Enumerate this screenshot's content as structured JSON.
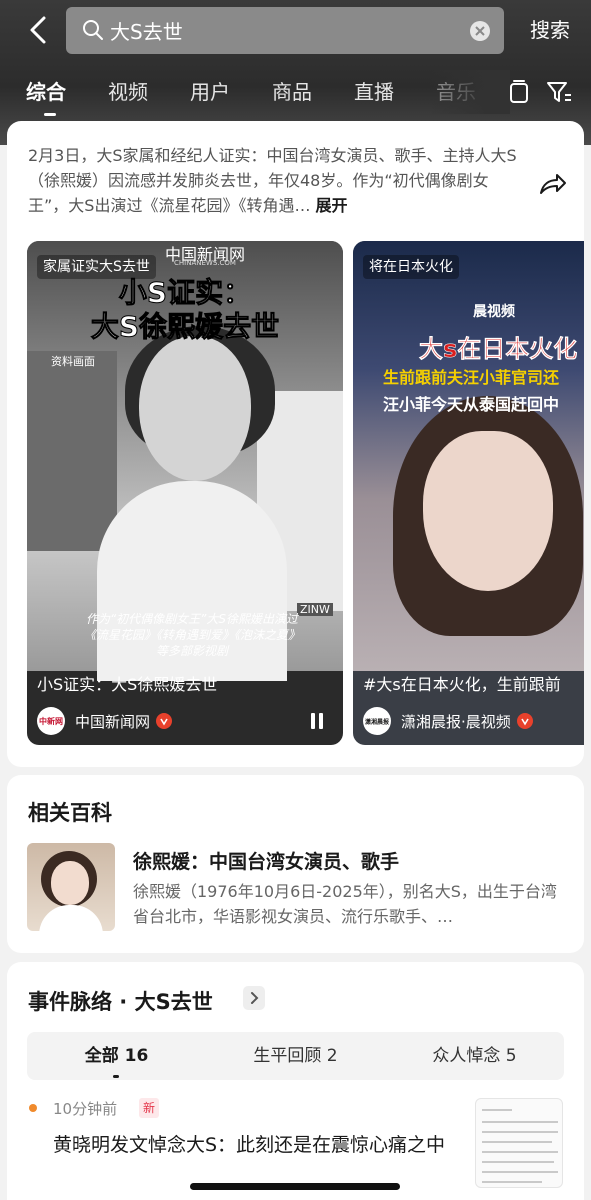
{
  "header": {
    "search_value": "大S去世",
    "search_button": "搜索",
    "tabs": [
      "综合",
      "视频",
      "用户",
      "商品",
      "直播",
      "音乐"
    ]
  },
  "summary": {
    "text": "2月3日，大S家属和经纪人证实：中国台湾女演员、歌手、主持人大S（徐熙媛）因流感并发肺炎去世，年仅48岁。作为“初代偶像剧女王”，大S出演过《流星花园》《转角遇…",
    "expand_label": "展开"
  },
  "videos": [
    {
      "badge": "家属证实大S去世",
      "logo_top": "中国新闻网",
      "logo_sub": "CHINANEWS.COM",
      "headline_line1": "小S证实：",
      "headline_line2": "大S徐熙媛去世",
      "archive_label": "资料画面",
      "overlay_caption": "作为“初代偶像剧女王”大S徐熙媛出演过《流星花园》《转角遇到爱》《泡沫之夏》等多部影视剧",
      "stage_sign": "ZINW",
      "caption": "小S证实：大S徐熙媛去世",
      "source_logo_text": "中新网",
      "source": "中国新闻网"
    },
    {
      "badge": "将在日本火化",
      "logo": "晨视频",
      "overlay_red": "大s在日本火化",
      "overlay_yellow": "生前跟前夫汪小菲官司还",
      "overlay_white": "汪小菲今天从泰国赶回中",
      "caption": "#大s在日本火化，生前跟前",
      "source_logo_text": "潇湘晨报",
      "source": "潇湘晨报·晨视频"
    }
  ],
  "wiki": {
    "section_title": "相关百科",
    "title": "徐熙媛：中国台湾女演员、歌手",
    "desc": "徐熙媛（1976年10月6日-2025年），别名大S，出生于台湾省台北市，华语影视女演员、流行乐歌手、…"
  },
  "timeline": {
    "title": "事件脉络 · 大S去世",
    "segments": [
      "全部 16",
      "生平回顾 2",
      "众人悼念 5"
    ],
    "item": {
      "time": "10分钟前",
      "badge": "新",
      "headline": "黄晓明发文悼念大S：此刻还是在震惊心痛之中"
    }
  },
  "colors": {
    "accent_red": "#e4364a",
    "dot_orange": "#f08a2c",
    "verified_red": "#e8412c"
  },
  "icons": [
    "back-icon",
    "search-icon",
    "clear-icon",
    "copy-icon",
    "filter-icon",
    "share-icon",
    "pause-icon",
    "verified-icon",
    "chevron-right-icon"
  ]
}
